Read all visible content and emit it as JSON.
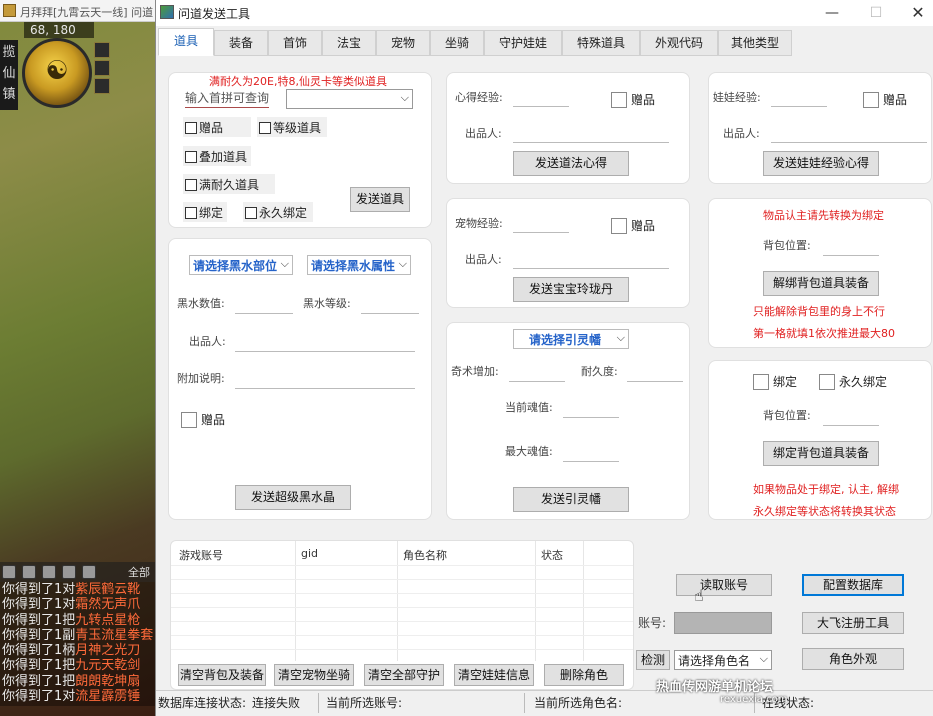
{
  "game": {
    "title": "月拜拜[九霄云天一线] 问道",
    "coords": "68, 180",
    "orb_glyph": "☯",
    "side_menu": [
      "揽",
      "仙",
      "镇"
    ],
    "chat_tab": "全部",
    "chat": [
      {
        "prefix": "你得到了1对",
        "item": "紫辰鹤云靴"
      },
      {
        "prefix": "你得到了1对",
        "item": "霜然无声爪"
      },
      {
        "prefix": "你得到了1把",
        "item": "九转点星枪"
      },
      {
        "prefix": "你得到了1副",
        "item": "青玉流星拳套"
      },
      {
        "prefix": "你得到了1柄",
        "item": "月神之光刀"
      },
      {
        "prefix": "你得到了1把",
        "item": "九元天乾剑"
      },
      {
        "prefix": "你得到了1把",
        "item": "朗朗乾坤扇"
      },
      {
        "prefix": "你得到了1对",
        "item": "流星霹雳锤"
      }
    ]
  },
  "window": {
    "title": "问道发送工具",
    "min": "—",
    "max": "☐",
    "close": "✕"
  },
  "tabs": [
    "道具",
    "装备",
    "首饰",
    "法宝",
    "宠物",
    "坐骑",
    "守护娃娃",
    "特殊道具",
    "外观代码",
    "其他类型"
  ],
  "item_panel": {
    "hint": "满耐久为20E,特8,仙灵卡等类似道具",
    "search_placeholder": "输入首拼可查询",
    "select_value": "",
    "gift": "赠品",
    "level_item": "等级道具",
    "stack_item": "叠加道具",
    "full_durability": "满耐久道具",
    "bind": "绑定",
    "perm_bind": "永久绑定",
    "send": "发送道具"
  },
  "black_water": {
    "part_select": "请选择黑水部位",
    "attr_select": "请选择黑水属性",
    "value_label": "黑水数值:",
    "level_label": "黑水等级:",
    "producer_label": "出品人:",
    "note_label": "附加说明:",
    "gift": "赠品",
    "send": "发送超级黑水晶"
  },
  "heart_panel": {
    "exp_label": "心得经验:",
    "gift": "赠品",
    "producer_label": "出品人:",
    "send": "发送道法心得"
  },
  "pet_panel": {
    "exp_label": "宠物经验:",
    "gift": "赠品",
    "producer_label": "出品人:",
    "send": "发送宝宝玲珑丹"
  },
  "soul_panel": {
    "select": "请选择引灵幡",
    "magic_label": "奇术增加:",
    "durability_label": "耐久度:",
    "current_label": "当前魂值:",
    "max_label": "最大魂值:",
    "send": "发送引灵幡"
  },
  "doll_panel": {
    "exp_label": "娃娃经验:",
    "gift": "赠品",
    "producer_label": "出品人:",
    "send": "发送娃娃经验心得"
  },
  "unbind_panel": {
    "hint": "物品认主请先转换为绑定",
    "slot_label": "背包位置:",
    "button": "解绑背包道具装备",
    "note1": "只能解除背包里的身上不行",
    "note2": "第一格就填1依次推进最大80"
  },
  "bind_panel": {
    "bind": "绑定",
    "perm_bind": "永久绑定",
    "slot_label": "背包位置:",
    "button": "绑定背包道具装备",
    "note1": "如果物品处于绑定, 认主, 解绑",
    "note2": "永久绑定等状态将转换其状态"
  },
  "table": {
    "columns": [
      "游戏账号",
      "gid",
      "角色名称",
      "状态"
    ],
    "rows": []
  },
  "table_buttons": [
    "清空背包及装备",
    "清空宠物坐骑",
    "清空全部守护",
    "清空娃娃信息",
    "删除角色"
  ],
  "account": {
    "read_button": "读取账号",
    "config_button": "配置数据库",
    "account_label": "账号:",
    "register_button": "大飞注册工具",
    "check_button": "检测",
    "role_select": "请选择角色名",
    "appearance_button": "角色外观"
  },
  "status": {
    "db_label": "数据库连接状态:",
    "db_value": "连接失败",
    "acct_label": "当前所选账号:",
    "acct_value": "",
    "role_label": "当前所选角色名:",
    "role_value": "",
    "online_label": "在线状态:"
  },
  "watermark": {
    "text": "热血传网游单机论坛",
    "url": "rexuexia.com"
  }
}
